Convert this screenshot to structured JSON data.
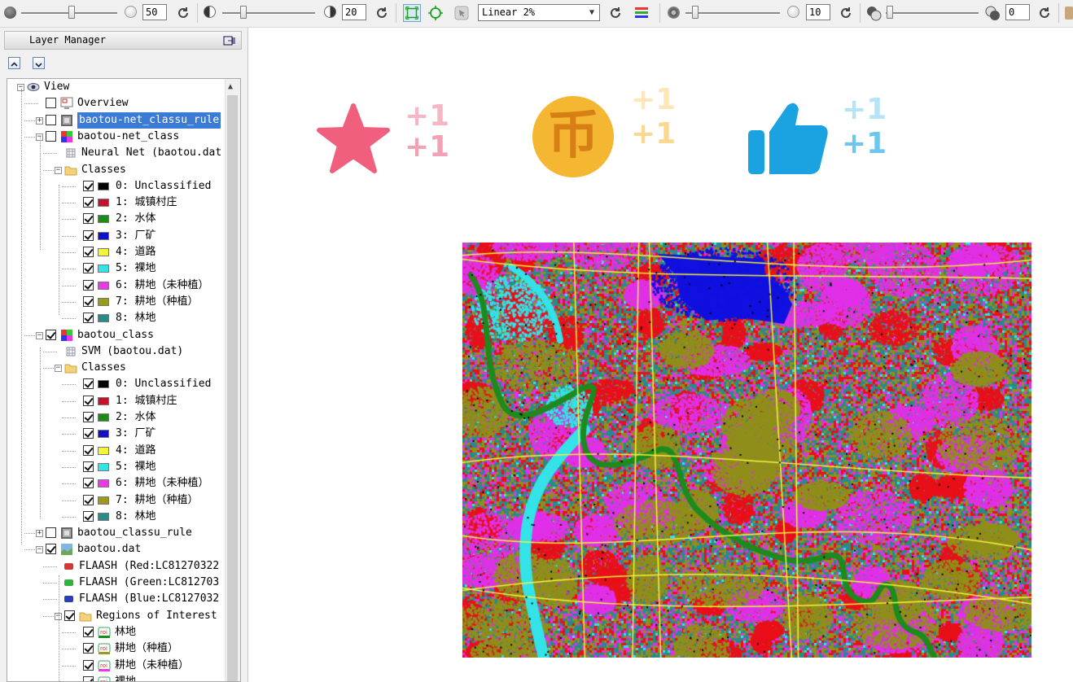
{
  "toolbar": {
    "brightness_value": "50",
    "contrast_value": "20",
    "stretch_label": "Linear 2%",
    "sharpen_value": "10",
    "transparency_value": "0"
  },
  "panel": {
    "title": "Layer Manager"
  },
  "tree": {
    "view": "View",
    "overview": "Overview",
    "rule_layer": "baotou-net_classu_rule",
    "net_class": "baotou-net_class",
    "neural_net": "Neural Net (baotou.dat",
    "classes": "Classes",
    "class_items_a": [
      {
        "label": "0: Unclassified",
        "color": "#000000"
      },
      {
        "label": "1: 城镇村庄",
        "color": "#c8102e"
      },
      {
        "label": "2: 水体",
        "color": "#1a8c1a"
      },
      {
        "label": "3: 厂矿",
        "color": "#1010c8"
      },
      {
        "label": "4: 道路",
        "color": "#f4f43a"
      },
      {
        "label": "5: 裸地",
        "color": "#33e3e8"
      },
      {
        "label": "6: 耕地（未种植）",
        "color": "#e83ae8"
      },
      {
        "label": "7: 耕地（种植）",
        "color": "#9a9a20"
      },
      {
        "label": "8: 林地",
        "color": "#2a8a8a"
      }
    ],
    "svm_class": "baotou_class",
    "svm": "SVM (baotou.dat)",
    "classes_b": "Classes",
    "class_items_b": [
      {
        "label": "0: Unclassified",
        "color": "#000000"
      },
      {
        "label": "1: 城镇村庄",
        "color": "#c8102e"
      },
      {
        "label": "2: 水体",
        "color": "#1a8c1a"
      },
      {
        "label": "3: 厂矿",
        "color": "#1010c8"
      },
      {
        "label": "4: 道路",
        "color": "#f4f43a"
      },
      {
        "label": "5: 裸地",
        "color": "#33e3e8"
      },
      {
        "label": "6: 耕地（未种植）",
        "color": "#e83ae8"
      },
      {
        "label": "7: 耕地（种植）",
        "color": "#9a9a20"
      },
      {
        "label": "8: 林地",
        "color": "#2a8a8a"
      }
    ],
    "classu_rule": "baotou_classu_rule",
    "baotou_dat": "baotou.dat",
    "flaash_red": "FLAASH (Red:LC81270322",
    "flaash_green": "FLAASH (Green:LC812703",
    "flaash_blue": "FLAASH (Blue:LC8127032",
    "roi_folder": "Regions of Interest",
    "roi_items": [
      {
        "label": "林地",
        "color": "#1a8c1a"
      },
      {
        "label": "耕地（种植）",
        "color": "#9a9a20"
      },
      {
        "label": "耕地（未种植）",
        "color": "#e83ae8"
      },
      {
        "label": "裸地",
        "color": "#33e3e8"
      }
    ]
  },
  "overlays": {
    "star_plus": "+1",
    "coin_plus": "+1",
    "thumb_plus": "+1",
    "coin_glyph": "币",
    "colors": {
      "star": "#f0607e",
      "coin": "#f5b731",
      "thumb": "#1aa3e0"
    }
  },
  "map": {
    "colors": {
      "unclassified": "#000000",
      "town": "#e8101a",
      "water": "#1c8a1c",
      "mine": "#1010e0",
      "road": "#f4f43a",
      "bare": "#33e3e8",
      "farm_bare": "#e030e8",
      "farm_planted": "#8f8f1a",
      "forest": "#2a8a8a"
    }
  }
}
